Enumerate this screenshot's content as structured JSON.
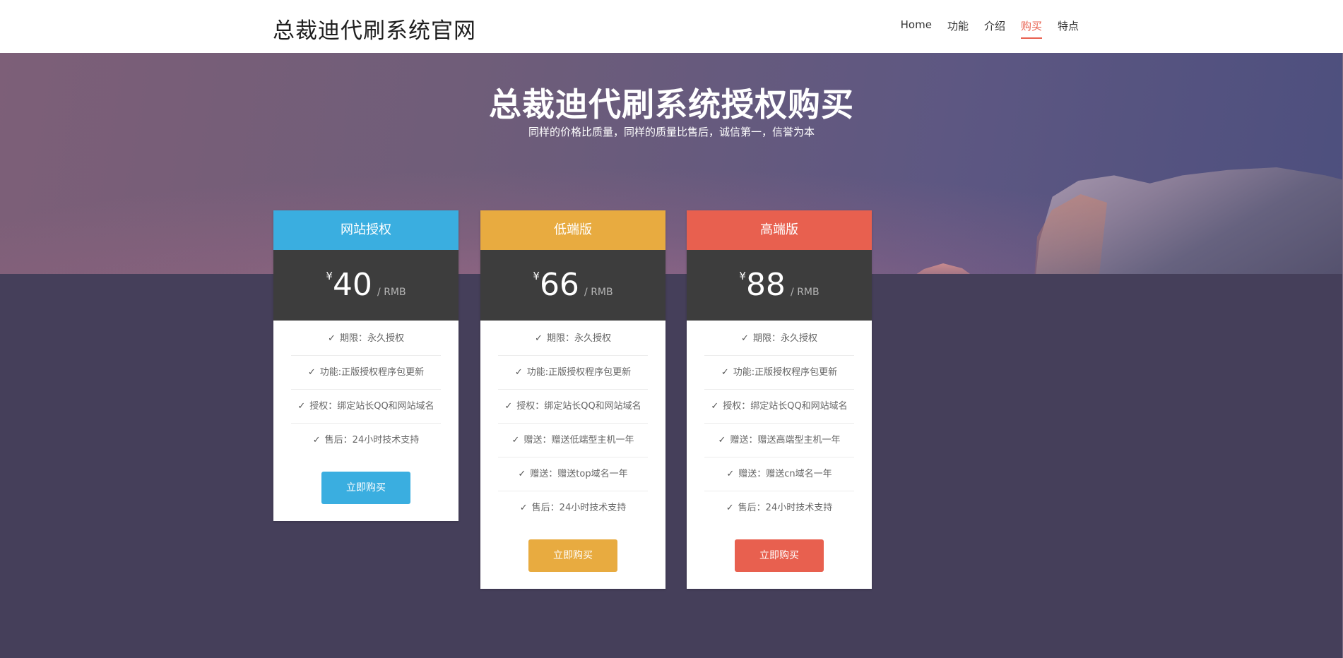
{
  "header": {
    "brand": "总裁迪代刷系统官网",
    "nav": [
      {
        "label": "Home"
      },
      {
        "label": "功能"
      },
      {
        "label": "介绍"
      },
      {
        "label": "购买",
        "active": true
      },
      {
        "label": "特点"
      }
    ]
  },
  "hero": {
    "title": "总裁迪代刷系统授权购买",
    "subtitle": "同样的价格比质量，同样的质量比售后，诚信第一，信誉为本"
  },
  "colors": {
    "blue": "#3aaee0",
    "orange": "#e8ab40",
    "red": "#e8604f",
    "price_band": "#3d3d3d",
    "active_nav": "#e8604f"
  },
  "plans": [
    {
      "name": "网站授权",
      "currency": "¥",
      "price": "40",
      "unit": "/ RMB",
      "features": [
        "期限：永久授权",
        "功能:正版授权程序包更新",
        "授权：绑定站长QQ和网站域名",
        "售后：24小时技术支持"
      ],
      "button": "立即购买"
    },
    {
      "name": "低端版",
      "currency": "¥",
      "price": "66",
      "unit": "/ RMB",
      "features": [
        "期限：永久授权",
        "功能:正版授权程序包更新",
        "授权：绑定站长QQ和网站域名",
        "赠送：赠送低端型主机一年",
        "赠送：赠送top域名一年",
        "售后：24小时技术支持"
      ],
      "button": "立即购买"
    },
    {
      "name": "高端版",
      "currency": "¥",
      "price": "88",
      "unit": "/ RMB",
      "features": [
        "期限：永久授权",
        "功能:正版授权程序包更新",
        "授权：绑定站长QQ和网站域名",
        "赠送：赠送高端型主机一年",
        "赠送：赠送cn域名一年",
        "售后：24小时技术支持"
      ],
      "button": "立即购买"
    }
  ]
}
